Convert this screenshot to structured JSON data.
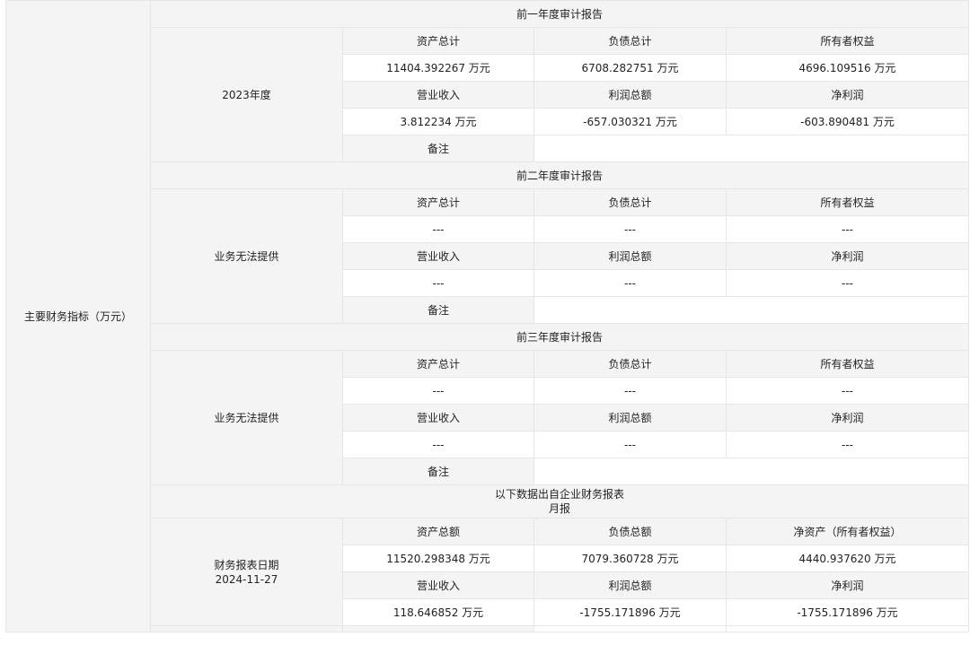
{
  "main_label": "主要财务指标（万元）",
  "sections": [
    {
      "title": "前一年度审计报告",
      "row_label": "2023年度",
      "headers1": [
        "资产总计",
        "负债总计",
        "所有者权益"
      ],
      "values1": [
        "11404.392267 万元",
        "6708.282751 万元",
        "4696.109516 万元"
      ],
      "headers2": [
        "营业收入",
        "利润总额",
        "净利润"
      ],
      "values2": [
        "3.812234 万元",
        "-657.030321 万元",
        "-603.890481 万元"
      ],
      "note_label": "备注",
      "note_value": ""
    },
    {
      "title": "前二年度审计报告",
      "row_label": "业务无法提供",
      "headers1": [
        "资产总计",
        "负债总计",
        "所有者权益"
      ],
      "values1": [
        "---",
        "---",
        "---"
      ],
      "headers2": [
        "营业收入",
        "利润总额",
        "净利润"
      ],
      "values2": [
        "---",
        "---",
        "---"
      ],
      "note_label": "备注",
      "note_value": ""
    },
    {
      "title": "前三年度审计报告",
      "row_label": "业务无法提供",
      "headers1": [
        "资产总计",
        "负债总计",
        "所有者权益"
      ],
      "values1": [
        "---",
        "---",
        "---"
      ],
      "headers2": [
        "营业收入",
        "利润总额",
        "净利润"
      ],
      "values2": [
        "---",
        "---",
        "---"
      ],
      "note_label": "备注",
      "note_value": ""
    }
  ],
  "monthly": {
    "title_line1": "以下数据出自企业财务报表",
    "title_line2": "月报",
    "row_label_line1": "财务报表日期",
    "row_label_line2": "2024-11-27",
    "headers1": [
      "资产总额",
      "负债总额",
      "净资产（所有者权益）"
    ],
    "values1": [
      "11520.298348 万元",
      "7079.360728 万元",
      "4440.937620 万元"
    ],
    "headers2": [
      "营业收入",
      "利润总额",
      "净利润"
    ],
    "values2": [
      "118.646852 万元",
      "-1755.171896 万元",
      "-1755.171896 万元"
    ]
  }
}
